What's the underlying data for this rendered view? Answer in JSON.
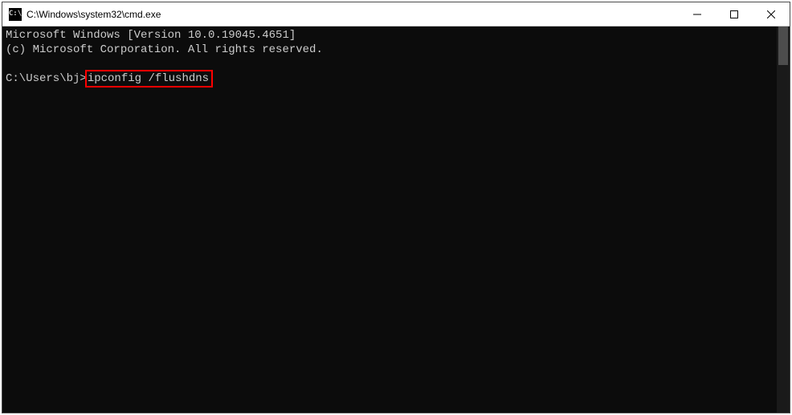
{
  "titlebar": {
    "icon_label": "C:\\",
    "title": "C:\\Windows\\system32\\cmd.exe"
  },
  "console": {
    "line1": "Microsoft Windows [Version 10.0.19045.4651]",
    "line2": "(c) Microsoft Corporation. All rights reserved.",
    "prompt": "C:\\Users\\bj>",
    "command": "ipconfig /flushdns"
  },
  "highlight_color": "#ff0000"
}
